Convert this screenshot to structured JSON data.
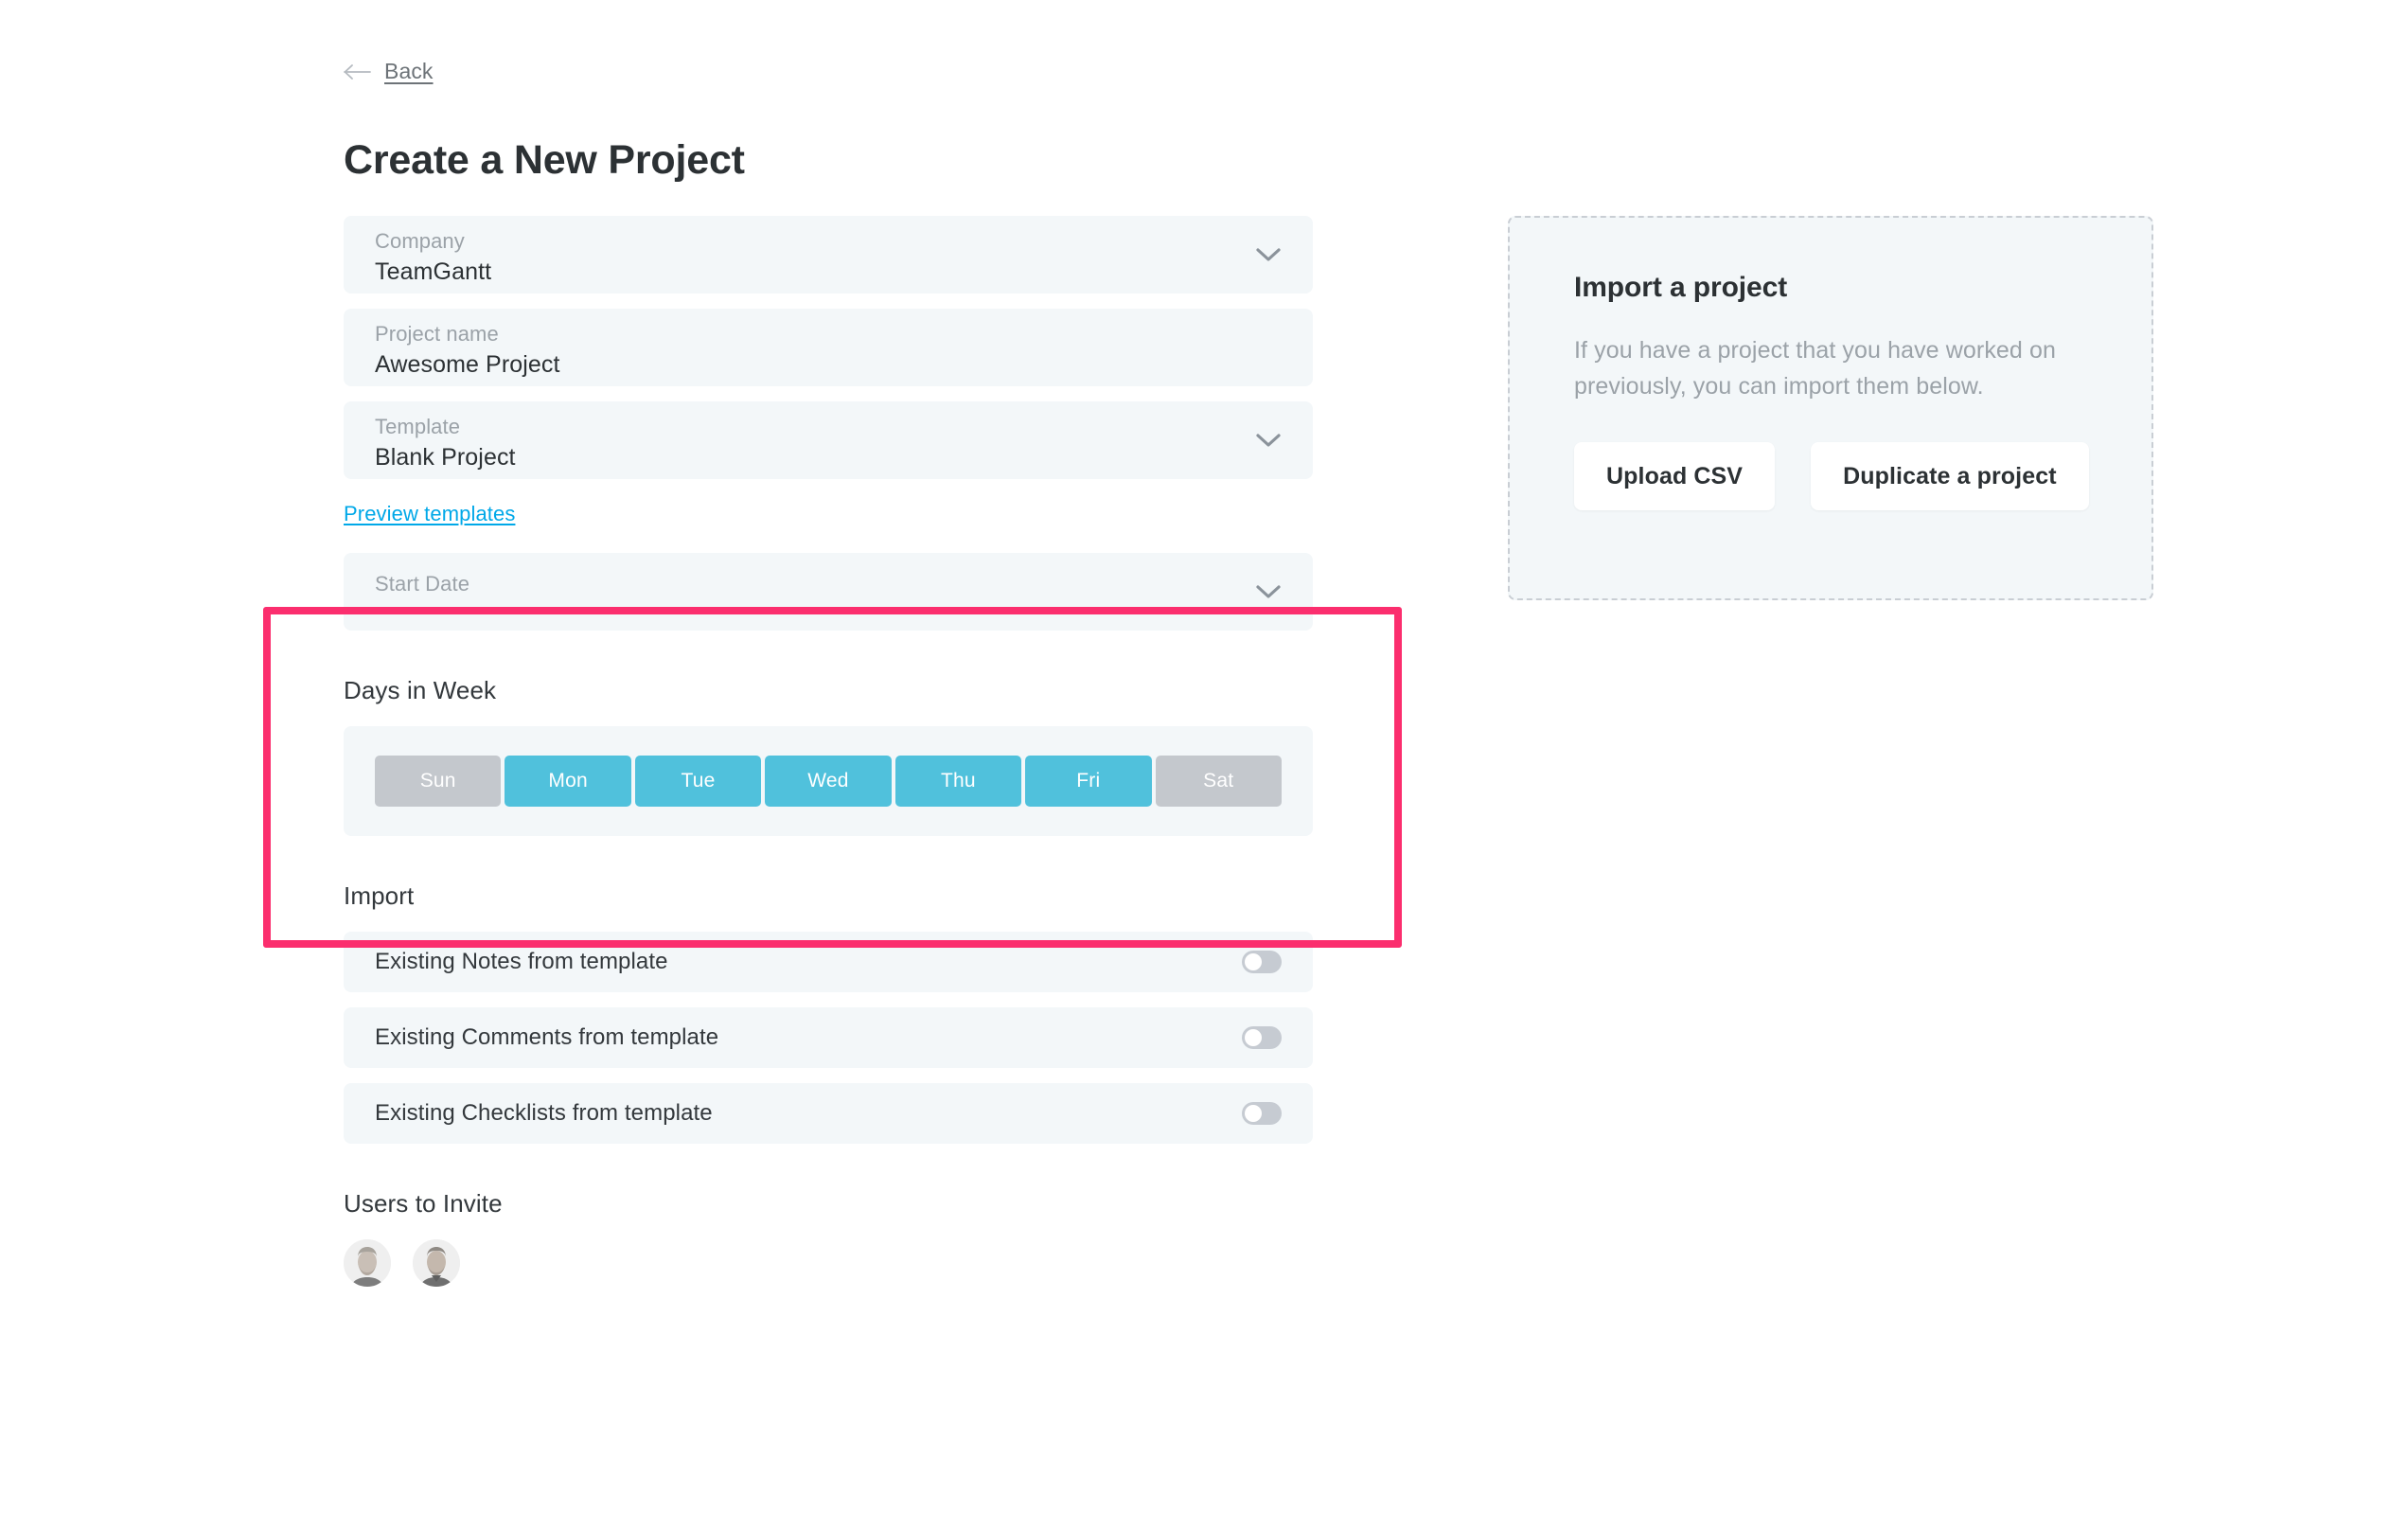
{
  "header": {
    "back_label": "Back",
    "back_icon": "arrow-left-icon",
    "title": "Create a New Project"
  },
  "form": {
    "fields": [
      {
        "label": "Company",
        "value": "TeamGantt",
        "type": "select",
        "icon": "chevron-down-icon"
      },
      {
        "label": "Project name",
        "value": "Awesome Project",
        "type": "text"
      },
      {
        "label": "Template",
        "value": "Blank Project",
        "type": "select",
        "icon": "chevron-down-icon"
      }
    ],
    "preview_link": "Preview templates",
    "start_date": {
      "label": "Start Date",
      "value": "",
      "placeholder": "Start Date",
      "icon": "chevron-down-icon"
    }
  },
  "days_in_week": {
    "heading": "Days in Week",
    "days": [
      {
        "label": "Sun",
        "selected": false
      },
      {
        "label": "Mon",
        "selected": true
      },
      {
        "label": "Tue",
        "selected": true
      },
      {
        "label": "Wed",
        "selected": true
      },
      {
        "label": "Thu",
        "selected": true
      },
      {
        "label": "Fri",
        "selected": true
      },
      {
        "label": "Sat",
        "selected": false
      }
    ],
    "selected_color": "#50c1dc",
    "unselected_color": "#c4c8cd"
  },
  "import_section": {
    "heading": "Import",
    "toggles": [
      {
        "label": "Existing Notes from template",
        "on": false
      },
      {
        "label": "Existing Comments from template",
        "on": false
      },
      {
        "label": "Existing Checklists from template",
        "on": false
      }
    ]
  },
  "users": {
    "heading": "Users to Invite",
    "avatars": [
      {
        "name": "avatar-user-1"
      },
      {
        "name": "avatar-user-2"
      }
    ]
  },
  "import_card": {
    "title": "Import a project",
    "description": "If you have a project that you have worked on previously, you can import them below.",
    "buttons": [
      {
        "label": "Upload CSV"
      },
      {
        "label": "Duplicate a project"
      }
    ]
  },
  "highlight": {
    "color": "#fb2e6e",
    "target": "start-date-and-days-in-week"
  }
}
